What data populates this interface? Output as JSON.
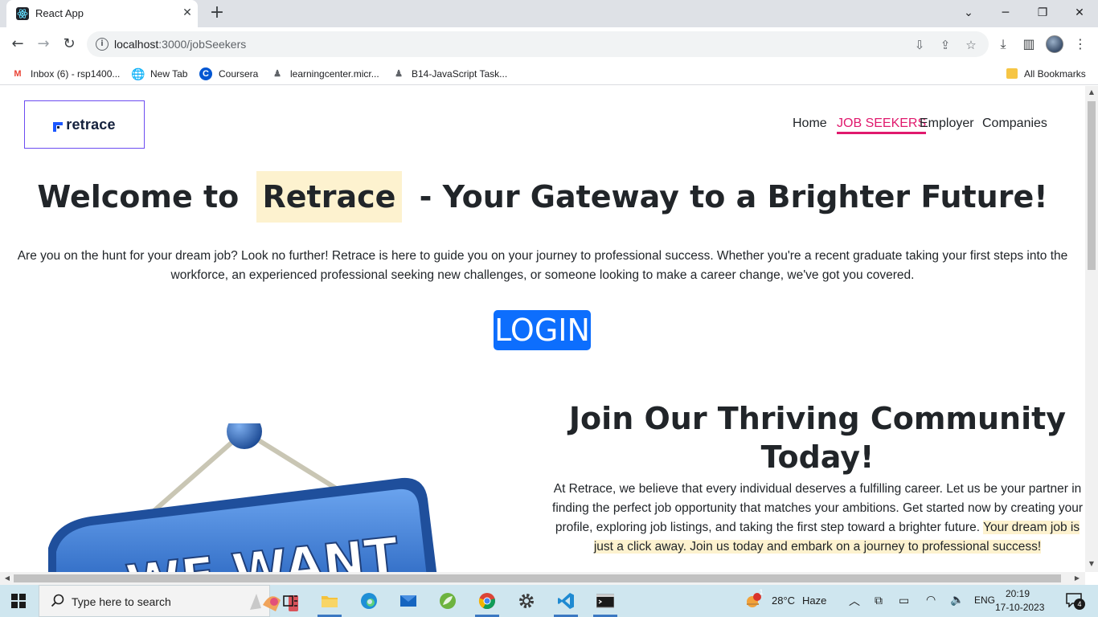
{
  "browser": {
    "tab_title": "React App",
    "url_host": "localhost",
    "url_path": ":3000/jobSeekers",
    "bookmarks": [
      {
        "label": "Inbox (6) - rsp1400...",
        "icon": "gmail-icon",
        "color": "#ea4335"
      },
      {
        "label": "New Tab",
        "icon": "globe-icon",
        "color": "#5f6368"
      },
      {
        "label": "Coursera",
        "icon": "coursera-icon",
        "color": "#0056d2"
      },
      {
        "label": "learningcenter.micr...",
        "icon": "user-icon",
        "color": "#5f6368"
      },
      {
        "label": "B14-JavaScript Task...",
        "icon": "user-icon",
        "color": "#5f6368"
      }
    ],
    "all_bookmarks_label": "All Bookmarks"
  },
  "page": {
    "logo_text": "retrace",
    "nav": [
      {
        "label": "Home",
        "active": false
      },
      {
        "label": "JOB SEEKERS",
        "active": true
      },
      {
        "label": "Employer",
        "active": false
      },
      {
        "label": "Companies",
        "active": false
      }
    ],
    "hero": {
      "title_before": "Welcome to",
      "title_brand": "Retrace",
      "title_after": "- Your Gateway to a Brighter Future!",
      "description": "Are you on the hunt for your dream job? Look no further! Retrace is here to guide you on your journey to professional success. Whether you're a recent graduate taking your first steps into the workforce, an experienced professional seeking new challenges, or someone looking to make a career change, we've got you covered.",
      "login_label": "LOGIN"
    },
    "sign_text": "WE WANT",
    "join": {
      "title": "Join Our Thriving Community Today!",
      "desc_plain": "At Retrace, we believe that every individual deserves a fulfilling career. Let us be your partner in finding the perfect job opportunity that matches your ambitions. Get started now by creating your profile, exploring job listings, and taking the first step toward a brighter future.",
      "desc_highlight": "Your dream job is just a click away. Join us today and embark on a journey to professional success!"
    }
  },
  "colors": {
    "accent_active": "#e0196d",
    "login_bg": "#0d6efd",
    "highlight": "#fdf2cf",
    "logo_border": "#6c4cf1"
  },
  "taskbar": {
    "search_placeholder": "Type here to search",
    "weather_temp": "28°C",
    "weather_desc": "Haze",
    "weather_badge": "1",
    "language": "ENG",
    "time": "20:19",
    "date": "17-10-2023",
    "notification_count": "4"
  }
}
